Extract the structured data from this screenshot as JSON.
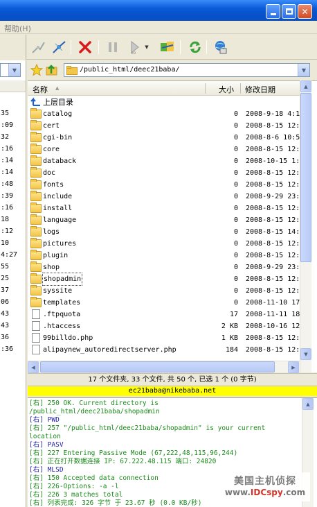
{
  "menu": {
    "help": "帮助(H)"
  },
  "address": {
    "path": "/public_html/deec21baba/"
  },
  "columns": {
    "name": "名称",
    "size": "大小",
    "modified": "修改日期"
  },
  "parent_dir_label": "上层目录",
  "files": [
    {
      "name": "catalog",
      "size": "0",
      "date": "2008-9-18 4:1",
      "type": "folder"
    },
    {
      "name": "cert",
      "size": "0",
      "date": "2008-8-15 12:",
      "type": "folder"
    },
    {
      "name": "cgi-bin",
      "size": "0",
      "date": "2008-8-6 10:5",
      "type": "folder"
    },
    {
      "name": "core",
      "size": "0",
      "date": "2008-8-15 12:",
      "type": "folder"
    },
    {
      "name": "databack",
      "size": "0",
      "date": "2008-10-15 1:",
      "type": "folder"
    },
    {
      "name": "doc",
      "size": "0",
      "date": "2008-8-15 12:",
      "type": "folder"
    },
    {
      "name": "fonts",
      "size": "0",
      "date": "2008-8-15 12:",
      "type": "folder"
    },
    {
      "name": "include",
      "size": "0",
      "date": "2008-9-29 23:",
      "type": "folder"
    },
    {
      "name": "install",
      "size": "0",
      "date": "2008-8-15 12:",
      "type": "folder"
    },
    {
      "name": "language",
      "size": "0",
      "date": "2008-8-15 12:",
      "type": "folder"
    },
    {
      "name": "logs",
      "size": "0",
      "date": "2008-8-15 14:",
      "type": "folder"
    },
    {
      "name": "pictures",
      "size": "0",
      "date": "2008-8-15 12:",
      "type": "folder"
    },
    {
      "name": "plugin",
      "size": "0",
      "date": "2008-8-15 12:",
      "type": "folder"
    },
    {
      "name": "shop",
      "size": "0",
      "date": "2008-9-29 23:",
      "type": "folder"
    },
    {
      "name": "shopadmin",
      "size": "0",
      "date": "2008-8-15 12:",
      "type": "folder"
    },
    {
      "name": "syssite",
      "size": "0",
      "date": "2008-8-15 12:",
      "type": "folder"
    },
    {
      "name": "templates",
      "size": "0",
      "date": "2008-11-10 17",
      "type": "folder"
    },
    {
      "name": ".ftpquota",
      "size": "17",
      "date": "2008-11-11 18",
      "type": "file"
    },
    {
      "name": ".htaccess",
      "size": "2 KB",
      "date": "2008-10-16 12",
      "type": "file"
    },
    {
      "name": "99billdo.php",
      "size": "1 KB",
      "date": "2008-8-15 12:",
      "type": "file"
    },
    {
      "name": "alipaynew_autoredirectserver.php",
      "size": "184",
      "date": "2008-8-15 12:",
      "type": "file"
    }
  ],
  "left_times": [
    "35",
    ":09",
    "32",
    ":16",
    ":14",
    ":14",
    ":48",
    ":39",
    ":16",
    "18",
    ":12",
    "10",
    "4:27",
    "55",
    "25",
    "37",
    "06",
    "43",
    "43",
    "36",
    ":36"
  ],
  "status": {
    "summary": "17 个文件夹, 33 个文件, 共 50 个, 已选 1 个 (0 字节)",
    "account": "ec21baba@nikebaba.net"
  },
  "log": [
    "[右] 250 OK. Current directory is",
    "/public_html/deec21baba/shopadmin",
    "[右] PWD",
    "[右] 257 \"/public_html/deec21baba/shopadmin\" is your current",
    "location",
    "[右] PASV",
    "[右] 227 Entering Passive Mode (67,222,48,115,96,244)",
    "[右] 正在打开数据连接 IP: 67.222.48.115 端口: 24820",
    "[右] MLSD",
    "[右] 150 Accepted data connection",
    "[右] 226-Options: -a -l",
    "[右] 226 3 matches total",
    "[右] 列表完成: 326 字节 于 23.67 秒 (0.0 KB/秒)"
  ],
  "watermark": {
    "line1": "美国主机侦探",
    "line2_prefix": "www.",
    "line2_brand": "IDCspy",
    "line2_suffix": ".com"
  },
  "colors": {
    "titlebar": "#0a5bd8",
    "status_highlight": "#ffff00",
    "log_text": "#1a8a1a",
    "log_prefix": "#1c1ca8"
  }
}
